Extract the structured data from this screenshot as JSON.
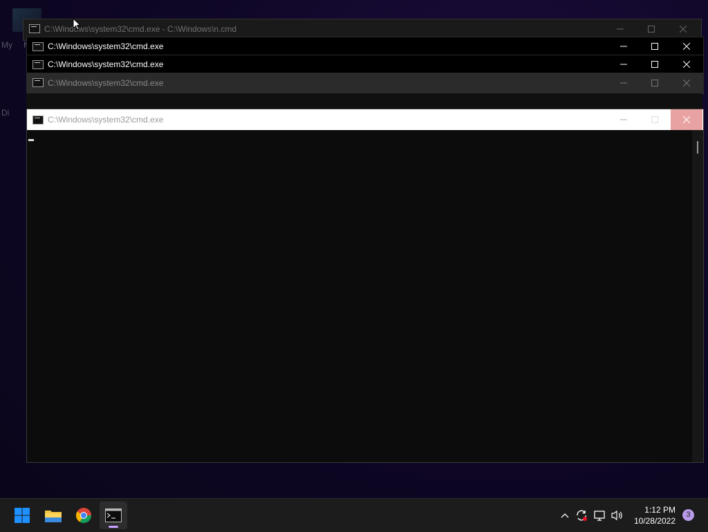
{
  "desktop": {
    "label_1": "My",
    "label_2": "M",
    "label_3": "Di"
  },
  "windows": [
    {
      "title": "C:\\Windows\\system32\\cmd.exe - C:\\Windows\\n.cmd",
      "state": "background"
    },
    {
      "title": "C:\\Windows\\system32\\cmd.exe",
      "state": "inactive"
    },
    {
      "title": "C:\\Windows\\system32\\cmd.exe",
      "state": "inactive"
    },
    {
      "title": "C:\\Windows\\system32\\cmd.exe",
      "state": "dim"
    },
    {
      "title": "C:\\Windows\\system32\\cmd.exe",
      "state": "focused"
    }
  ],
  "taskbar": {
    "apps": [
      "start-icon",
      "file-explorer-icon",
      "chrome-icon",
      "terminal-icon"
    ],
    "clock_time": "1:12 PM",
    "clock_date": "10/28/2022",
    "notification_count": "3"
  },
  "colors": {
    "accent": "#c9a0ff",
    "close_hover": "#e8a2a2",
    "start_blue": "#1e90ff"
  }
}
